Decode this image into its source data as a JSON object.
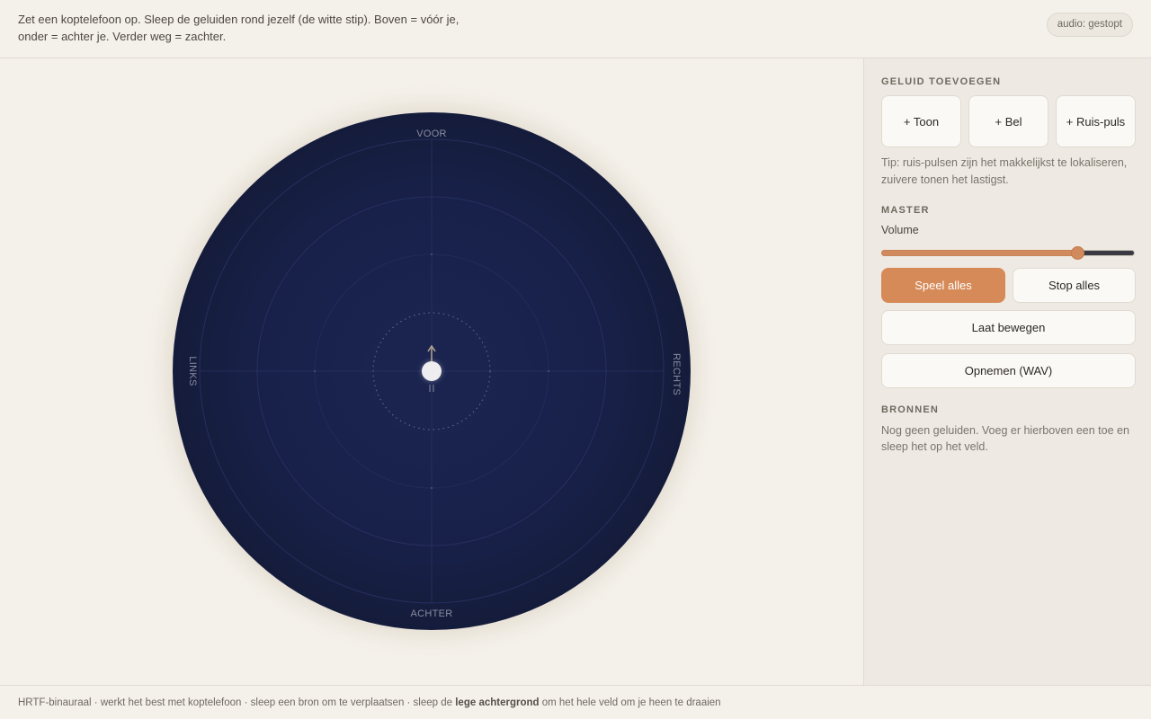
{
  "header": {
    "intro": "Zet een koptelefoon op. Sleep de geluiden rond jezelf (de witte stip). Boven = vóór je, onder = achter je. Verder weg = zachter.",
    "status": "audio: gestopt"
  },
  "field": {
    "front": "VOOR",
    "back": "ACHTER",
    "left": "LINKS",
    "right": "RECHTS"
  },
  "sidebar": {
    "add_title": "GELUID TOEVOEGEN",
    "add_buttons": [
      "+ Toon",
      "+ Bel",
      "+ Ruis-puls"
    ],
    "tip": "Tip: ruis-pulsen zijn het makkelijkst te lokaliseren, zuivere tonen het lastigst.",
    "master_title": "MASTER",
    "volume_label": "Volume",
    "volume_value": 0.79,
    "play_all": "Speel alles",
    "stop_all": "Stop alles",
    "move": "Laat bewegen",
    "record": "Opnemen (WAV)",
    "sources_title": "BRONNEN",
    "sources_empty": "Nog geen geluiden. Voeg er hierboven een toe en sleep het op het veld."
  },
  "footer": {
    "text_before": "HRTF-binauraal · werkt het best met koptelefoon · sleep een bron om te verplaatsen · sleep de ",
    "text_bold": "lege achtergrond",
    "text_after": " om het hele veld om je heen te draaien"
  },
  "colors": {
    "accent": "#d58a58",
    "field": "#18214a",
    "background": "#f4f1ea"
  }
}
